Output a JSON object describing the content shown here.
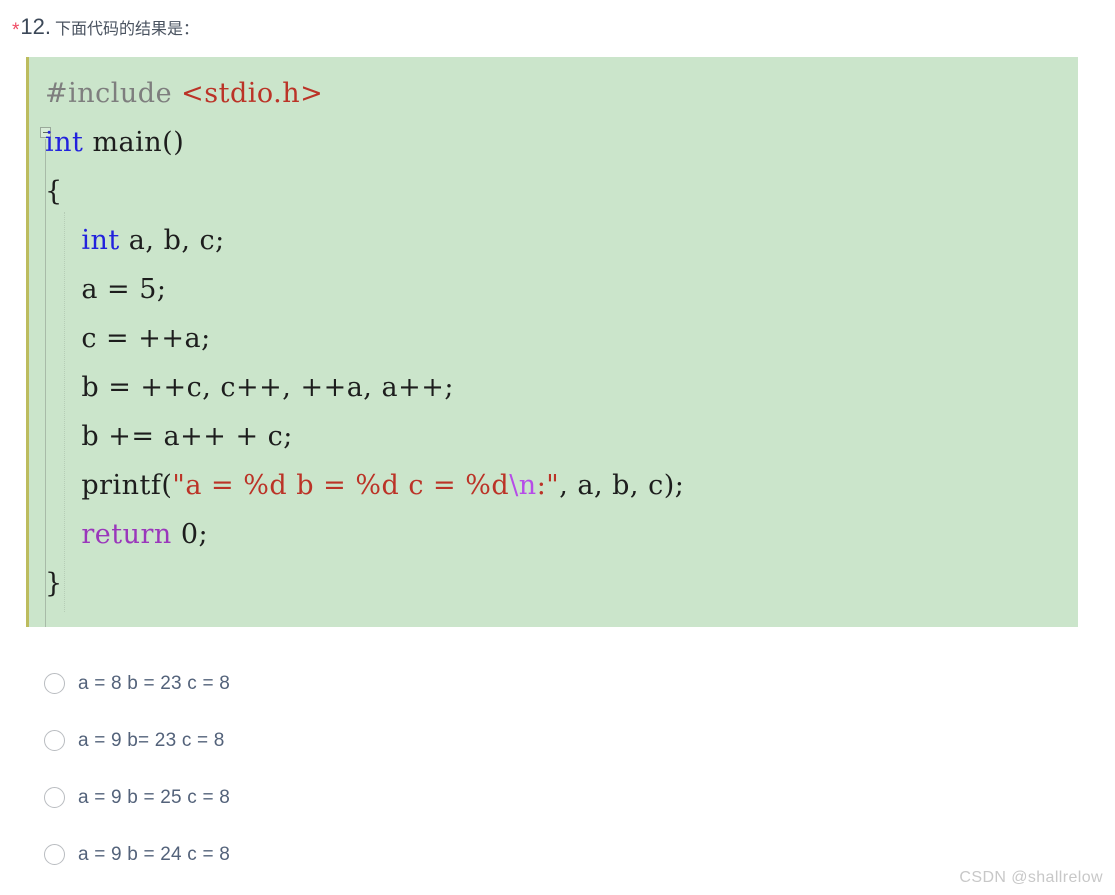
{
  "question": {
    "required_marker": "*",
    "number": "12.",
    "text": "下面代码的结果是：",
    "asterisk_color": "#ef4b64"
  },
  "code_block": {
    "background_color": "#cbe5cb",
    "accent_border_color": "#bcbc5e",
    "language": "c",
    "fold_marker": "−",
    "lines": [
      {
        "id": "line-1",
        "tokens": [
          {
            "text": "#include ",
            "type": "preprocessor"
          },
          {
            "text": "<stdio.h>",
            "type": "header"
          }
        ]
      },
      {
        "id": "line-2",
        "tokens": [
          {
            "text": "int",
            "type": "keyword"
          },
          {
            "text": " main()",
            "type": "plain"
          }
        ]
      },
      {
        "id": "line-3",
        "tokens": [
          {
            "text": "{",
            "type": "plain"
          }
        ]
      },
      {
        "id": "line-4",
        "tokens": [
          {
            "text": "    ",
            "type": "plain"
          },
          {
            "text": "int",
            "type": "keyword"
          },
          {
            "text": " a, b, c;",
            "type": "plain"
          }
        ]
      },
      {
        "id": "line-5",
        "tokens": [
          {
            "text": "    a = 5;",
            "type": "plain"
          }
        ]
      },
      {
        "id": "line-6",
        "tokens": [
          {
            "text": "    c = ++a;",
            "type": "plain"
          }
        ]
      },
      {
        "id": "line-7",
        "tokens": [
          {
            "text": "    b = ++c, c++, ++a, a++;",
            "type": "plain"
          }
        ]
      },
      {
        "id": "line-8",
        "tokens": [
          {
            "text": "    b += a++ + c;",
            "type": "plain"
          }
        ]
      },
      {
        "id": "line-9",
        "tokens": [
          {
            "text": "    printf(",
            "type": "plain"
          },
          {
            "text": "\"a = %d b = %d c = %d",
            "type": "string"
          },
          {
            "text": "\\n",
            "type": "escape"
          },
          {
            "text": ":\"",
            "type": "string"
          },
          {
            "text": ", a, b, c);",
            "type": "plain"
          }
        ]
      },
      {
        "id": "line-10",
        "tokens": [
          {
            "text": "    ",
            "type": "plain"
          },
          {
            "text": "return",
            "type": "keyword2"
          },
          {
            "text": " 0;",
            "type": "plain"
          }
        ]
      },
      {
        "id": "line-11",
        "tokens": [
          {
            "text": "}",
            "type": "plain"
          }
        ]
      }
    ],
    "syntax_colors": {
      "preprocessor": "#7e7e7e",
      "header": "#bb3327",
      "keyword": "#2222dd",
      "keyword2": "#9a37bb",
      "string": "#bb3327",
      "escape": "#b64ce8",
      "plain": "#1d1d1d"
    }
  },
  "options": [
    {
      "id": "option-a",
      "label": "a = 8 b = 23 c = 8",
      "selected": false
    },
    {
      "id": "option-b",
      "label": "a = 9 b= 23 c = 8",
      "selected": false
    },
    {
      "id": "option-c",
      "label": "a = 9 b = 25 c = 8",
      "selected": false
    },
    {
      "id": "option-d",
      "label": "a = 9 b = 24 c = 8",
      "selected": false
    }
  ],
  "watermark": {
    "text": "CSDN @shallrelow",
    "color": "#c8c8c8"
  }
}
